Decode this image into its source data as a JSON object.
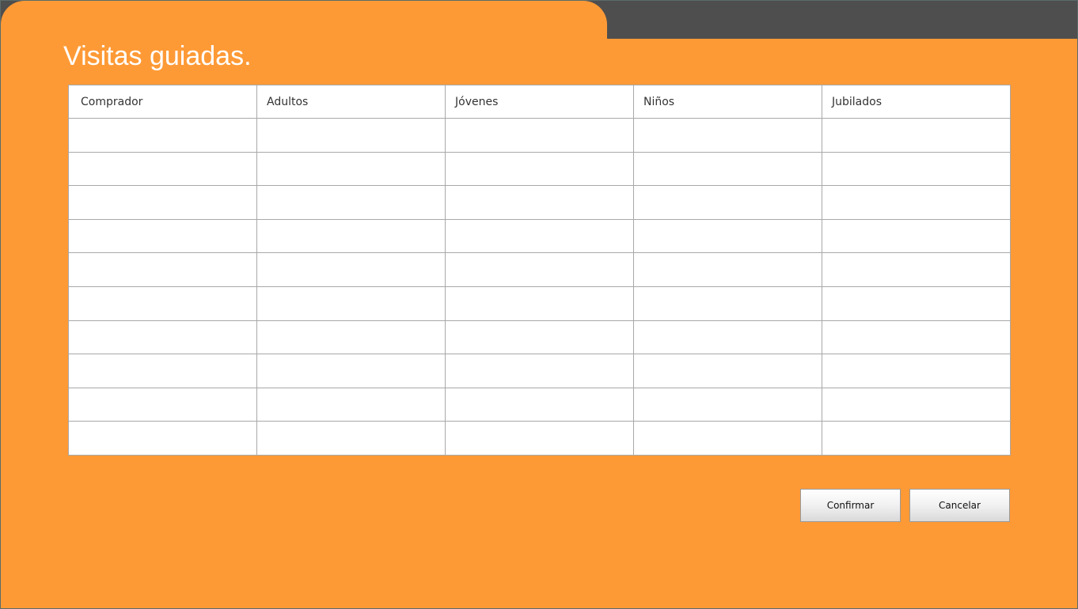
{
  "page": {
    "title": "Visitas guiadas."
  },
  "colors": {
    "background": "#fe9a36",
    "top_bar": "#4e4e4e",
    "title_text": "#ffffff",
    "table_border": "#a8a8a8"
  },
  "table": {
    "columns": [
      "Comprador",
      "Adultos",
      "Jóvenes",
      "Niños",
      "Jubilados"
    ],
    "rows": [
      [
        "",
        "",
        "",
        "",
        ""
      ],
      [
        "",
        "",
        "",
        "",
        ""
      ],
      [
        "",
        "",
        "",
        "",
        ""
      ],
      [
        "",
        "",
        "",
        "",
        ""
      ],
      [
        "",
        "",
        "",
        "",
        ""
      ],
      [
        "",
        "",
        "",
        "",
        ""
      ],
      [
        "",
        "",
        "",
        "",
        ""
      ],
      [
        "",
        "",
        "",
        "",
        ""
      ],
      [
        "",
        "",
        "",
        "",
        ""
      ],
      [
        "",
        "",
        "",
        "",
        ""
      ]
    ]
  },
  "actions": {
    "confirm_label": "Confirmar",
    "cancel_label": "Cancelar"
  }
}
